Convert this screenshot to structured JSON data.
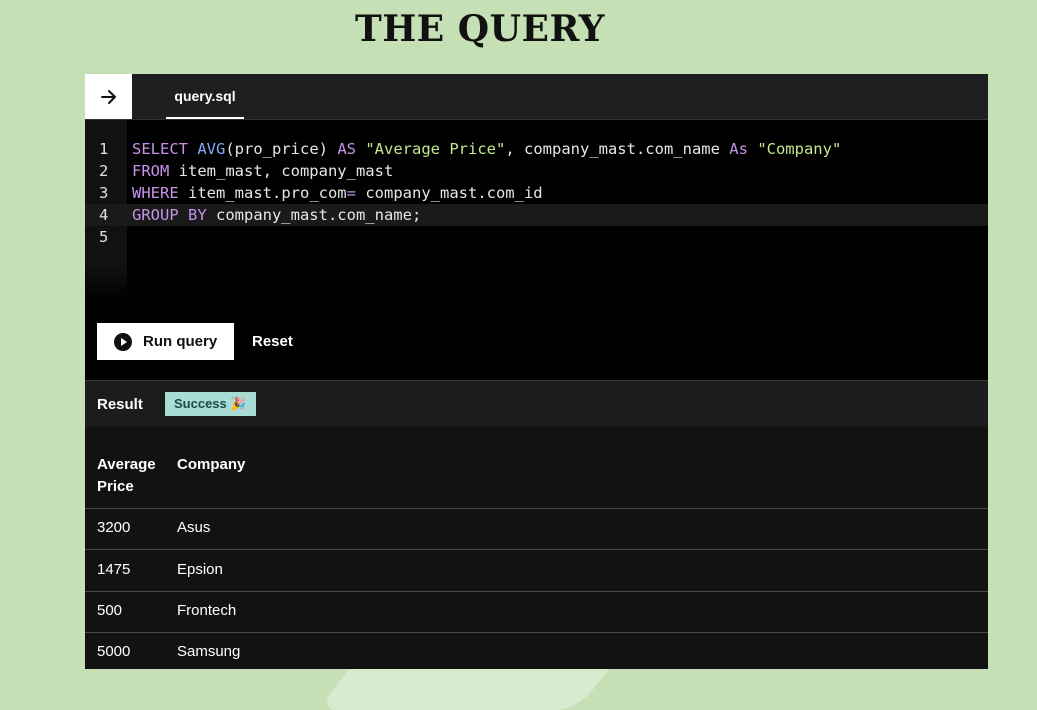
{
  "page": {
    "title": "THE QUERY"
  },
  "tab": {
    "label": "query.sql"
  },
  "editor": {
    "lines": [
      {
        "num": "1",
        "tokens": [
          {
            "t": "kw",
            "v": "SELECT"
          },
          {
            "t": "",
            "v": " "
          },
          {
            "t": "fn",
            "v": "AVG"
          },
          {
            "t": "",
            "v": "(pro_price) "
          },
          {
            "t": "kw",
            "v": "AS"
          },
          {
            "t": "",
            "v": " "
          },
          {
            "t": "str",
            "v": "\"Average Price\""
          },
          {
            "t": "",
            "v": ", company_mast.com_name "
          },
          {
            "t": "kw",
            "v": "As"
          },
          {
            "t": "",
            "v": " "
          },
          {
            "t": "str",
            "v": "\"Company\""
          }
        ]
      },
      {
        "num": "2",
        "tokens": [
          {
            "t": "kw",
            "v": "FROM"
          },
          {
            "t": "",
            "v": " item_mast, company_mast"
          }
        ]
      },
      {
        "num": "3",
        "tokens": [
          {
            "t": "kw",
            "v": "WHERE"
          },
          {
            "t": "",
            "v": " item_mast.pro_com"
          },
          {
            "t": "kw",
            "v": "="
          },
          {
            "t": "",
            "v": " company_mast.com_id"
          }
        ]
      },
      {
        "num": "4",
        "active": true,
        "tokens": [
          {
            "t": "kw",
            "v": "GROUP BY"
          },
          {
            "t": "",
            "v": " company_mast.com_name;"
          }
        ]
      },
      {
        "num": "5",
        "tokens": []
      }
    ]
  },
  "actions": {
    "run_label": "Run query",
    "reset_label": "Reset"
  },
  "result": {
    "label": "Result",
    "status": "Success 🎉",
    "columns": [
      "Average\nPrice",
      "Company"
    ],
    "rows": [
      [
        "3200",
        "Asus"
      ],
      [
        "1475",
        "Epsion"
      ],
      [
        "500",
        "Frontech"
      ],
      [
        "5000",
        "Samsung"
      ]
    ]
  },
  "colors": {
    "background": "#c5e0b4",
    "keyword": "#c792ea",
    "function": "#82aaff",
    "string": "#c3e88d",
    "success_badge": "#a9dcd5"
  },
  "icons": {
    "back": "arrow-right-icon",
    "run": "play-circle-icon"
  }
}
